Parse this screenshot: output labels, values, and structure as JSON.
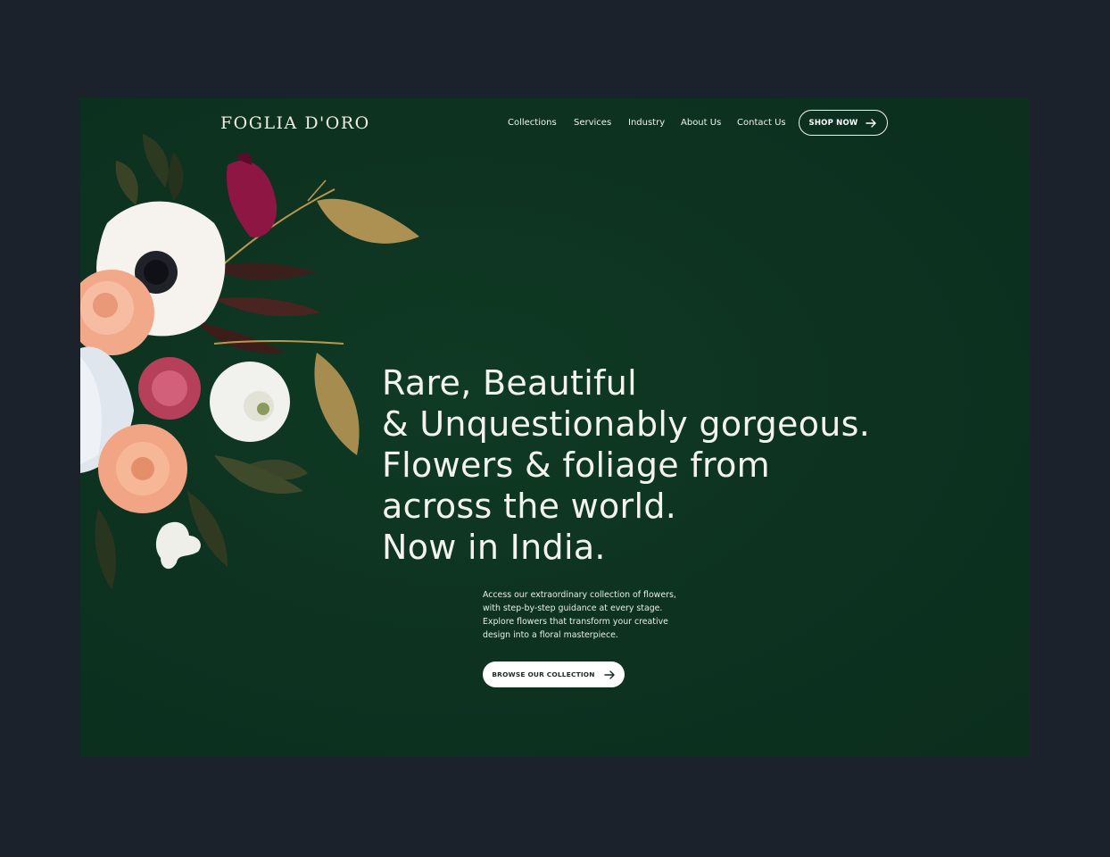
{
  "brand": {
    "logo_text": "FOGLIA D'ORO"
  },
  "nav": {
    "items": [
      {
        "label": "Collections"
      },
      {
        "label": "Services"
      },
      {
        "label": "Industry"
      },
      {
        "label": "About Us"
      },
      {
        "label": "Contact Us"
      }
    ],
    "cta_label": "SHOP NOW"
  },
  "hero": {
    "headline_lines": [
      "Rare, Beautiful",
      "& Unquestionably gorgeous.",
      "Flowers & foliage from",
      "across the world.",
      "Now in India."
    ],
    "description_lines": [
      "Access our extraordinary collection of flowers,",
      "with step-by-step guidance at every stage.",
      "Explore flowers that transform your creative",
      "design into a floral masterpiece."
    ],
    "cta_label": "BROWSE OUR COLLECTION"
  },
  "icons": {
    "arrow": "arrow-right-icon",
    "image": "flower-bouquet-image"
  },
  "colors": {
    "page_background": "#1c222b",
    "hero_background": "#0d3220",
    "text_light": "#f4f2ee",
    "button_background": "#ffffff",
    "button_text": "#1a2a20"
  }
}
